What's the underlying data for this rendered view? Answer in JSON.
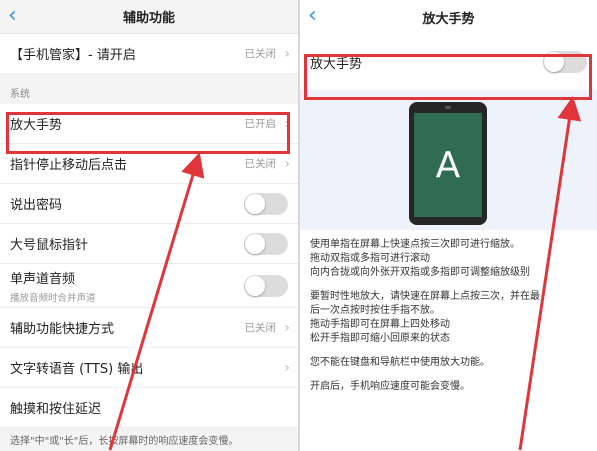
{
  "left": {
    "header": {
      "back": "‹",
      "title": "辅助功能"
    },
    "top_row": {
      "label": "【手机管家】- 请开启",
      "value": "已关闭"
    },
    "section_label": "系统",
    "rows": [
      {
        "label": "放大手势",
        "value": "已开启",
        "kind": "chevron"
      },
      {
        "label": "指针停止移动后点击",
        "value": "已关闭",
        "kind": "chevron"
      },
      {
        "label": "说出密码",
        "kind": "toggle",
        "on": false
      },
      {
        "label": "大号鼠标指针",
        "kind": "toggle",
        "on": false
      },
      {
        "label": "单声道音频",
        "sub": "播放音频时合并声道",
        "kind": "toggle",
        "on": false
      },
      {
        "label": "辅助功能快捷方式",
        "value": "已关闭",
        "kind": "chevron"
      },
      {
        "label": "文字转语音 (TTS) 输出",
        "kind": "chevron"
      },
      {
        "label": "触摸和按住延迟",
        "kind": "none"
      }
    ],
    "footer": "选择\"中\"或\"长\"后，长按屏幕时的响应速度会变慢。"
  },
  "right": {
    "header": {
      "back": "‹",
      "title": "放大手势"
    },
    "toggle_row": {
      "label": "放大手势",
      "on": false
    },
    "illustration_letter": "A",
    "desc": [
      [
        "使用单指在屏幕上快速点按三次即可进行缩放。",
        "拖动双指或多指可进行滚动",
        "向内合拢或向外张开双指或多指即可调整缩放级别"
      ],
      [
        "要暂时性地放大，请快速在屏幕上点按三次，并在最",
        "后一次点按时按住手指不放。",
        "拖动手指即可在屏幕上四处移动",
        "松开手指即可缩小回原来的状态"
      ],
      [
        "您不能在键盘和导航栏中使用放大功能。"
      ],
      [
        "开启后，手机响应速度可能会变慢。"
      ]
    ]
  },
  "colors": {
    "accent": "#3a8ee6",
    "highlight": "#e0363b",
    "illustration_bg": "#eef3fb",
    "phone_screen": "#2f6c52"
  },
  "icons": {
    "back": "chevron-left-icon",
    "chevron": "chevron-right-icon"
  }
}
